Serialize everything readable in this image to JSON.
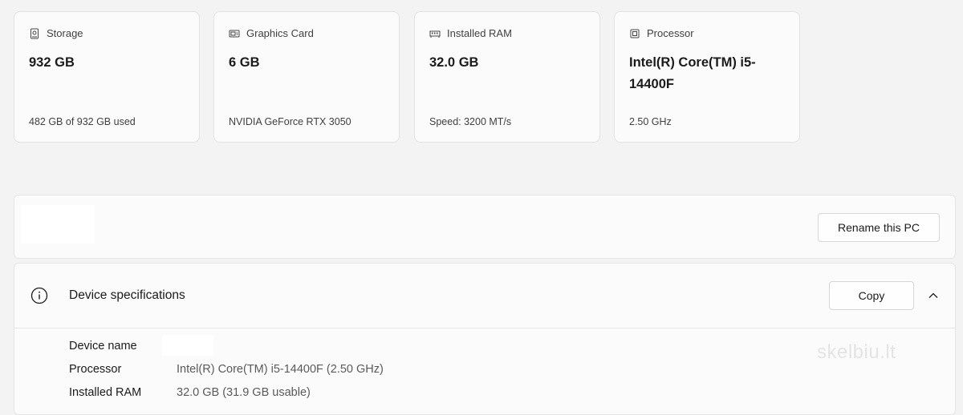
{
  "cards": [
    {
      "title": "Storage",
      "value": "932 GB",
      "sub": "482 GB of 932 GB used",
      "icon": "storage-icon"
    },
    {
      "title": "Graphics Card",
      "value": "6 GB",
      "sub": "NVIDIA GeForce RTX 3050",
      "icon": "graphics-card-icon"
    },
    {
      "title": "Installed RAM",
      "value": "32.0 GB",
      "sub": "Speed: 3200 MT/s",
      "icon": "ram-icon"
    },
    {
      "title": "Processor",
      "value": "Intel(R) Core(TM) i5-14400F",
      "sub": "2.50 GHz",
      "icon": "processor-icon"
    }
  ],
  "rename": {
    "button_label": "Rename this PC"
  },
  "specs": {
    "title": "Device specifications",
    "copy_label": "Copy",
    "rows": [
      {
        "label": "Device name",
        "value": ""
      },
      {
        "label": "Processor",
        "value": "Intel(R) Core(TM) i5-14400F (2.50 GHz)"
      },
      {
        "label": "Installed RAM",
        "value": "32.0 GB (31.9 GB usable)"
      }
    ]
  },
  "watermark": "skelbiu.lt",
  "colors": {
    "background": "#f3f3f3",
    "card": "#fbfbfb",
    "border": "#e3e3e3"
  }
}
